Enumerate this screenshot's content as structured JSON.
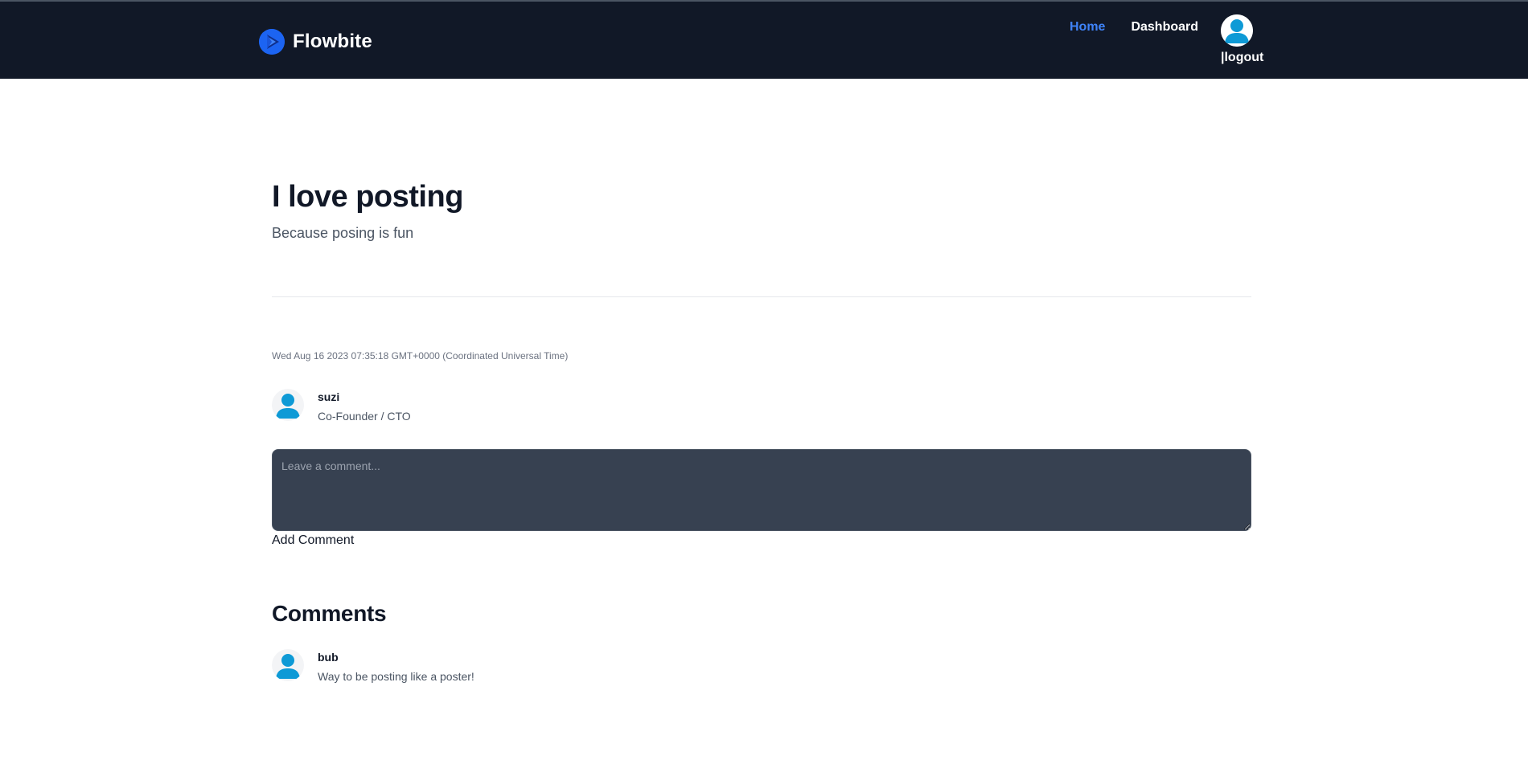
{
  "navbar": {
    "brand": "Flowbite",
    "links": [
      {
        "label": "Home",
        "active": true
      },
      {
        "label": "Dashboard",
        "active": false
      }
    ],
    "logout_label": "|logout",
    "accent_color": "#3f83f8",
    "background_color": "#111827"
  },
  "post": {
    "title": "I love posting",
    "subtitle": "Because posing is fun",
    "date": "Wed Aug 16 2023 07:35:18 GMT+0000 (Coordinated Universal Time)",
    "author": {
      "name": "suzi",
      "role": "Co-Founder / CTO",
      "avatar_icon": "user-avatar-icon"
    }
  },
  "comment_form": {
    "placeholder": "Leave a comment...",
    "value": "",
    "submit_label": "Add Comment"
  },
  "comments": {
    "heading": "Comments",
    "items": [
      {
        "author": "bub",
        "text": "Way to be posting like a poster!",
        "avatar_icon": "user-avatar-icon"
      }
    ]
  }
}
